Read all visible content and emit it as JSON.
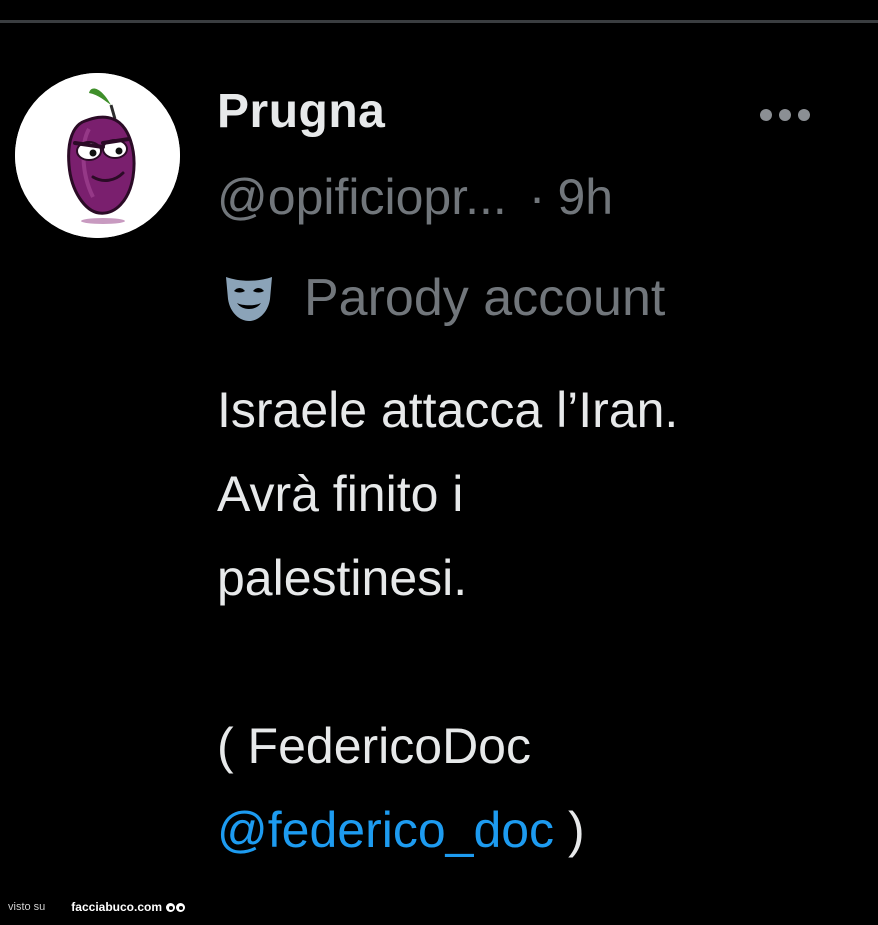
{
  "tweet": {
    "author_name": "Prugna",
    "handle": "@opificiopr...",
    "separator": "·",
    "time": "9h",
    "parody_label": "Parody account",
    "more_icon": "more-horizontal-icon",
    "body_lines": [
      "Israele attacca l’Iran.",
      "Avrà finito i",
      "palestinesi.",
      "( FedericoDoc"
    ],
    "mention": "@federico_doc",
    "mention_suffix": " )"
  },
  "footer": {
    "prefix": "visto su",
    "brand": "facciabuco.com"
  },
  "colors": {
    "background": "#000000",
    "text": "#e7e9ea",
    "muted": "#71767b",
    "link": "#1d9bf0",
    "avatar_plum": "#7a1f6e"
  }
}
